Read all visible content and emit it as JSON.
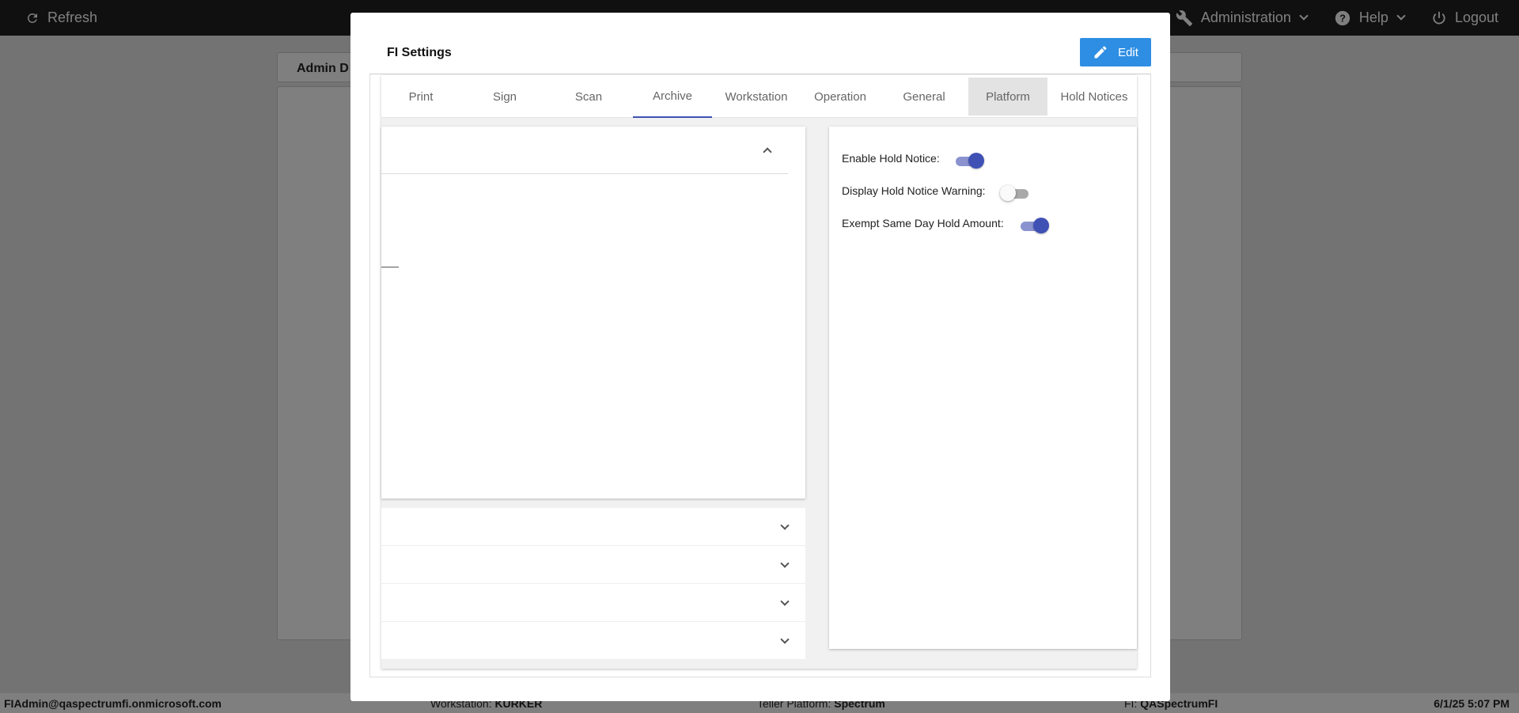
{
  "topbar": {
    "refresh_label": "Refresh",
    "nav": {
      "administration": "Administration",
      "help": "Help",
      "logout": "Logout"
    }
  },
  "background": {
    "header_title": "Admin D"
  },
  "modal": {
    "title": "FI Settings",
    "edit_label": "Edit",
    "tabs": [
      "Print",
      "Sign",
      "Scan",
      "Archive",
      "Workstation",
      "Operation",
      "General",
      "Platform",
      "Hold Notices"
    ],
    "active_tab": "Archive",
    "hovered_tab": "Platform",
    "settings": [
      {
        "label": "Enable Hold Notice:",
        "enabled": true
      },
      {
        "label": "Display Hold Notice Warning:",
        "enabled": false
      },
      {
        "label": "Exempt Same Day Hold Amount:",
        "enabled": true
      }
    ]
  },
  "footer": {
    "user": "FIAdmin@qaspectrumfi.onmicrosoft.com",
    "workstation_label": "Workstation:",
    "workstation_value": "KURKER",
    "teller_label": "Teller Platform:",
    "teller_value": "Spectrum",
    "fi_label": "FI:",
    "fi_value": "QASpectrumFI",
    "datetime": "6/1/25 5:07 PM"
  },
  "colors": {
    "accent": "#3f51b5",
    "edit_button": "#2e8ee3",
    "topbar": "#212121"
  }
}
